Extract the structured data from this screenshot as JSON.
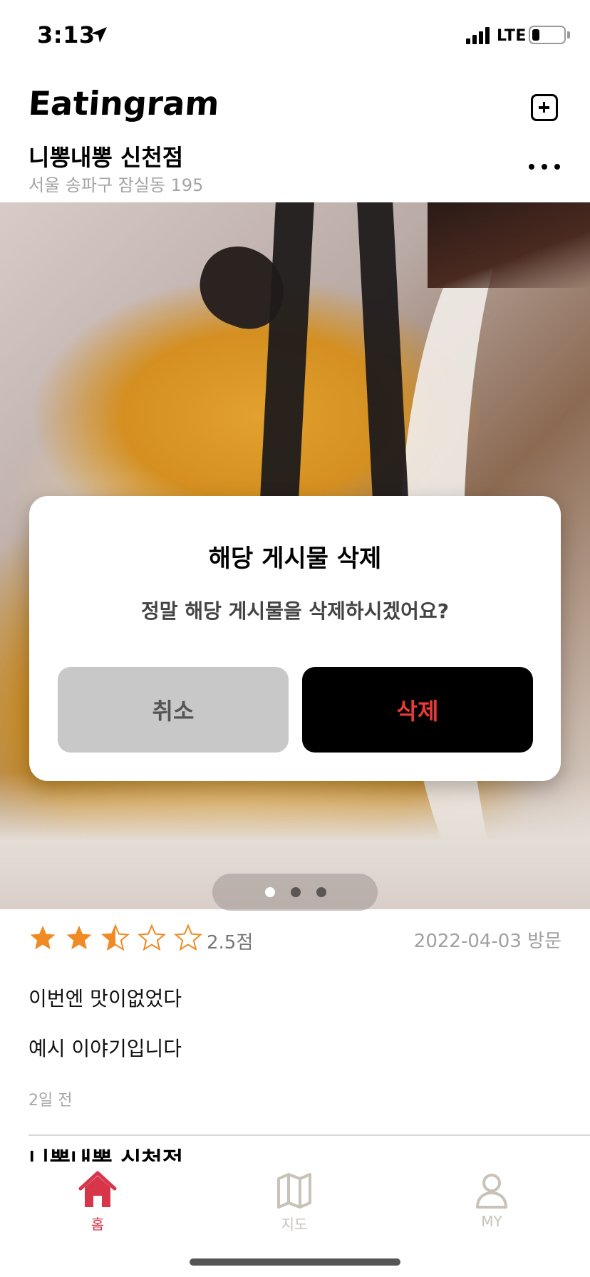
{
  "status_bar": {
    "time": "3:13",
    "network": "LTE"
  },
  "header": {
    "app_title": "Eatingram",
    "add_icon": "plus-square-icon"
  },
  "post": {
    "place_name": "니뽕내뽕 신천점",
    "address": "서울 송파구 잠실동 195",
    "photo_pages": 3,
    "current_page": 1,
    "rating": 2.5,
    "rating_text": "2.5점",
    "visit_date": "2022-04-03 방문",
    "review_line_1": "이번엔 맛이없었다",
    "review_line_2": "예시 이야기입니다",
    "time_ago": "2일 전"
  },
  "next_post": {
    "place_name": "니뽕내뽕 신천점"
  },
  "dialog": {
    "title": "해당 게시물 삭제",
    "message": "정말 해당 게시물을 삭제하시겠어요?",
    "cancel_label": "취소",
    "delete_label": "삭제",
    "delete_color": "#ea3a3a"
  },
  "tabbar": {
    "home_label": "홈",
    "map_label": "지도",
    "my_label": "MY",
    "active_color": "#d7364a",
    "inactive_color": "#c9c2b8"
  },
  "colors": {
    "star": "#f08a24"
  }
}
